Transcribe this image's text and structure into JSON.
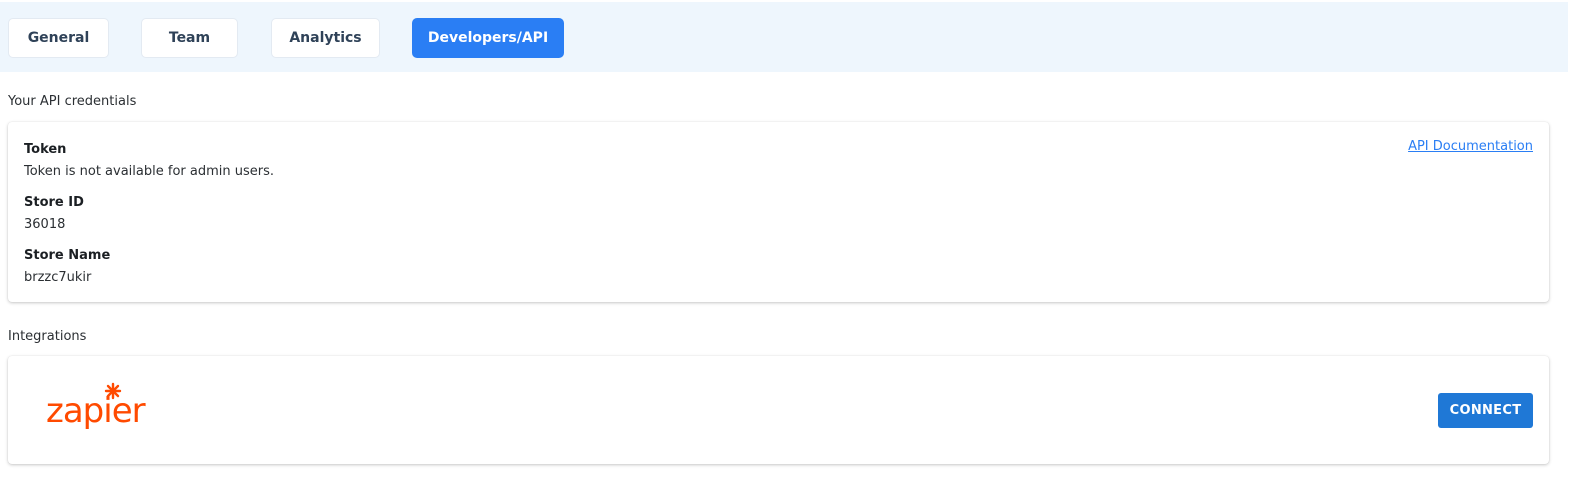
{
  "tabs": [
    {
      "label": "General",
      "active": false
    },
    {
      "label": "Team",
      "active": false
    },
    {
      "label": "Analytics",
      "active": false
    },
    {
      "label": "Developers/API",
      "active": true
    }
  ],
  "credentials": {
    "section_label": "Your API credentials",
    "doc_link": "API Documentation",
    "token_title": "Token",
    "token_value": "Token is not available for admin users.",
    "store_id_title": "Store ID",
    "store_id_value": "36018",
    "store_name_title": "Store Name",
    "store_name_value": "brzzc7ukir"
  },
  "integrations": {
    "section_label": "Integrations",
    "items": [
      {
        "logo_text": "zapier",
        "logo_icon": "zapier-logo",
        "button_label": "CONNECT"
      }
    ]
  },
  "colors": {
    "tabs_bar_bg": "#eef6fd",
    "active_tab": "#2a7ef4",
    "connect_button": "#1f78d6",
    "zapier_brand": "#ff4a00",
    "link": "#2a7ef4"
  }
}
